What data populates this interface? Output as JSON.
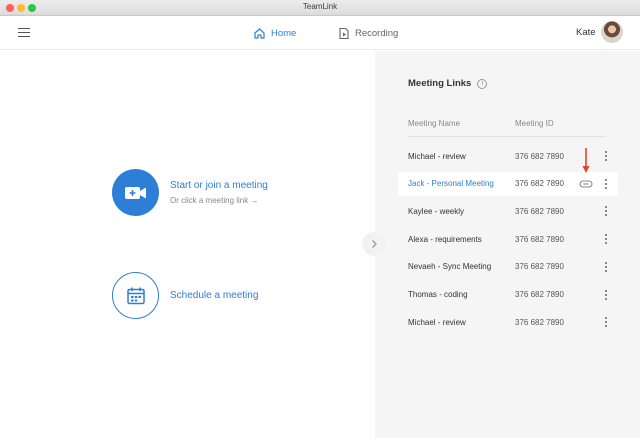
{
  "window": {
    "title": "TeamLink"
  },
  "header": {
    "tabs": [
      {
        "label": "Home",
        "icon": "home-icon",
        "active": true
      },
      {
        "label": "Recording",
        "icon": "recording-icon",
        "active": false
      }
    ],
    "user_name": "Kate"
  },
  "left": {
    "start": {
      "title": "Start or join a meeting",
      "subtitle": "Or click a meeting link →"
    },
    "schedule": {
      "title": "Schedule a meeting"
    }
  },
  "panel": {
    "title": "Meeting Links",
    "columns": [
      "Meeting Name",
      "Meeting ID"
    ],
    "rows": [
      {
        "name": "Michael - review",
        "id": "376 682 7890"
      },
      {
        "name": "Jack - Personal Meeting",
        "id": "376 682 7890"
      },
      {
        "name": "Kaylee - weekly",
        "id": "376 682 7890"
      },
      {
        "name": "Alexa - requirements",
        "id": "376 682 7890"
      },
      {
        "name": "Nevaeh - Sync Meeting",
        "id": "376 682 7890"
      },
      {
        "name": "Thomas - coding",
        "id": "376 682 7890"
      },
      {
        "name": "Michael - review",
        "id": "376 682 7890"
      }
    ],
    "active_row": 1
  },
  "colors": {
    "accent": "#2d7ed6",
    "panel_bg": "#f5f5f5",
    "marker": "#e0452b"
  }
}
